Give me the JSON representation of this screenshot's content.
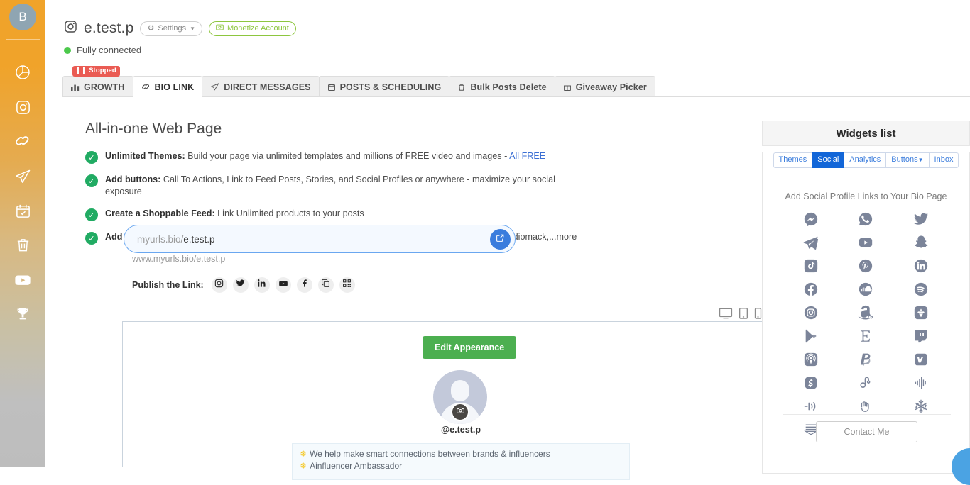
{
  "sidebar": {
    "avatar_initial": "B",
    "items": [
      {
        "icon": "pie-chart-icon",
        "name": "analytics"
      },
      {
        "icon": "instagram-icon",
        "name": "instagram"
      },
      {
        "icon": "link-icon",
        "name": "bio-link"
      },
      {
        "icon": "paper-plane-icon",
        "name": "direct-messages"
      },
      {
        "icon": "calendar-check-icon",
        "name": "scheduling"
      },
      {
        "icon": "trash-icon",
        "name": "bulk-delete"
      },
      {
        "icon": "youtube-icon",
        "name": "youtube"
      },
      {
        "icon": "trophy-icon",
        "name": "giveaway"
      }
    ]
  },
  "header": {
    "platform_icon": "instagram-icon",
    "account_name": "e.test.p",
    "settings_label": "Settings",
    "monetize_label": "Monetize Account",
    "status_text": "Fully connected",
    "status_color": "#4cc94c"
  },
  "tabs": {
    "stopped_badge": "Stopped",
    "items": [
      {
        "label": "GROWTH",
        "icon": "bar-chart-icon",
        "active": false
      },
      {
        "label": "BIO LINK",
        "icon": "link-icon",
        "active": true
      },
      {
        "label": "DIRECT MESSAGES",
        "icon": "paper-plane-icon",
        "active": false
      },
      {
        "label": "POSTS & SCHEDULING",
        "icon": "calendar-icon",
        "active": false
      },
      {
        "label": "Bulk Posts Delete",
        "icon": "trash-icon",
        "active": false
      },
      {
        "label": "Giveaway Picker",
        "icon": "gift-icon",
        "active": false
      }
    ]
  },
  "features": {
    "title": "All-in-one Web Page",
    "rows": [
      {
        "bold": "Unlimited Themes:",
        "text": " Build your page via unlimited templates and millions of FREE video and images - ",
        "link": "All FREE"
      },
      {
        "bold": "Add buttons:",
        "text": " Call To Actions, Link to Feed Posts, Stories, and Social Profiles or anywhere - maximize your social exposure",
        "link": ""
      },
      {
        "bold": "Create a Shoppable Feed:",
        "text": " Link Unlimited products to your posts",
        "link": ""
      },
      {
        "bold": "Add Music Albums:",
        "text": " from any music platform; Apple music, Spotify, Soundcloud, Youtube, Amazon, Audiomack,...more",
        "link": ""
      }
    ]
  },
  "url_field": {
    "prefix": "myurls.bio/",
    "slug": "e.test.p",
    "go_icon": "external-link-icon",
    "subtext": "www.myurls.bio/e.test.p"
  },
  "publish": {
    "label": "Publish the Link:",
    "icons": [
      "instagram-icon",
      "twitter-icon",
      "linkedin-icon",
      "youtube-icon",
      "facebook-icon",
      "copy-icon",
      "qr-code-icon"
    ]
  },
  "devices": [
    {
      "name": "desktop-preview-icon"
    },
    {
      "name": "tablet-preview-icon"
    },
    {
      "name": "mobile-preview-icon"
    },
    {
      "name": "responsive-preview-icon"
    }
  ],
  "preview": {
    "edit_appearance_label": "Edit Appearance",
    "avatar_camera_icon": "camera-icon",
    "handle": "@e.test.p",
    "bio_lines": [
      "We help make smart connections between brands & influencers",
      "Ainfluencer Ambassador"
    ]
  },
  "widgets": {
    "title": "Widgets list",
    "tabs": [
      {
        "label": "Themes",
        "active": false
      },
      {
        "label": "Social",
        "active": true
      },
      {
        "label": "Analytics",
        "active": false
      },
      {
        "label": "Buttons",
        "active": false,
        "caret": true
      },
      {
        "label": "Inbox",
        "active": false
      }
    ],
    "panel_title": "Add Social Profile Links to Your Bio Page",
    "social_icons": [
      "messenger-icon",
      "whatsapp-icon",
      "twitter-icon",
      "telegram-icon",
      "youtube-icon",
      "snapchat-icon",
      "tiktok-icon",
      "pinterest-icon",
      "linkedin-icon",
      "facebook-icon",
      "soundcloud-icon",
      "spotify-icon",
      "instagram-icon",
      "amazon-icon",
      "app-store-icon",
      "google-play-icon",
      "etsy-icon",
      "twitch-icon",
      "podcast-icon",
      "paypal-icon",
      "vimeo-icon",
      "cash-app-icon",
      "audiomack-icon",
      "audio-wave-icon",
      "sound-icon",
      "clubhouse-icon",
      "snowflake-icon",
      "bandsintown-icon"
    ],
    "contact_label": "Contact Me"
  },
  "chat_widget": {
    "name": "support-chat-bubble"
  }
}
